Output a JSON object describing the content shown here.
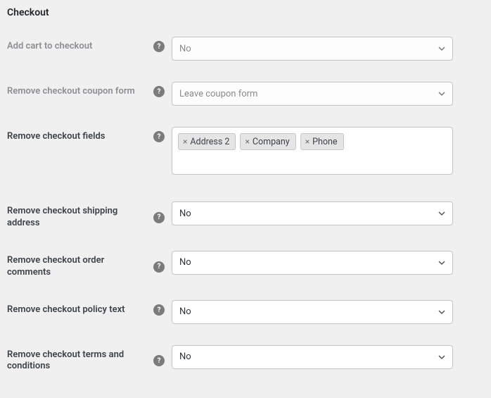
{
  "title": "Checkout",
  "fields": {
    "add_cart": {
      "label": "Add cart to checkout",
      "value": "No"
    },
    "remove_coupon": {
      "label": "Remove checkout coupon form",
      "value": "Leave coupon form"
    },
    "remove_fields": {
      "label": "Remove checkout fields",
      "tags": [
        "Address 2",
        "Company",
        "Phone"
      ]
    },
    "remove_shipping": {
      "label": "Remove checkout shipping address",
      "value": "No"
    },
    "remove_comments": {
      "label": "Remove checkout order comments",
      "value": "No"
    },
    "remove_policy": {
      "label": "Remove checkout policy text",
      "value": "No"
    },
    "remove_terms": {
      "label": "Remove checkout terms and conditions",
      "value": "No"
    }
  },
  "icons": {
    "help": "?"
  }
}
